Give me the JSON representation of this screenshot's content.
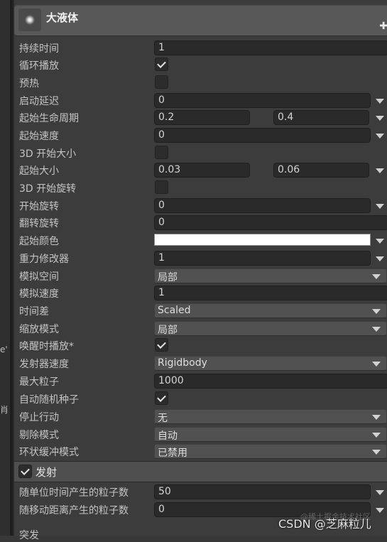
{
  "header": {
    "title": "大液体",
    "icon": "particle-system-icon",
    "add_icon": "plus-icon"
  },
  "rows": {
    "duration": {
      "label": "持续时间",
      "value": "1"
    },
    "looping": {
      "label": "循环播放",
      "checked": true
    },
    "prewarm": {
      "label": "预热",
      "checked": false
    },
    "start_delay": {
      "label": "启动延迟",
      "value": "0"
    },
    "start_lifetime": {
      "label": "起始生命周期",
      "min": "0.2",
      "max": "0.4"
    },
    "start_speed": {
      "label": "起始速度",
      "value": "0"
    },
    "start_size_3d": {
      "label": "3D 开始大小",
      "checked": false
    },
    "start_size": {
      "label": "起始大小",
      "min": "0.03",
      "max": "0.06"
    },
    "start_rotation_3d": {
      "label": "3D 开始旋转",
      "checked": false
    },
    "start_rotation": {
      "label": "开始旋转",
      "value": "0"
    },
    "flip_rotation": {
      "label": "翻转旋转",
      "value": "0"
    },
    "start_color": {
      "label": "起始颜色",
      "color": "#ffffff"
    },
    "gravity_modifier": {
      "label": "重力修改器",
      "value": "1"
    },
    "simulation_space": {
      "label": "模拟空间",
      "selected": "局部"
    },
    "simulation_speed": {
      "label": "模拟速度",
      "value": "1"
    },
    "delta_time": {
      "label": "时间差",
      "selected": "Scaled"
    },
    "scaling_mode": {
      "label": "缩放模式",
      "selected": "局部"
    },
    "play_on_awake": {
      "label": "唤醒时播放*",
      "checked": true
    },
    "emitter_velocity": {
      "label": "发射器速度",
      "selected": "Rigidbody"
    },
    "max_particles": {
      "label": "最大粒子",
      "value": "1000"
    },
    "auto_random_seed": {
      "label": "自动随机种子",
      "checked": true
    },
    "stop_action": {
      "label": "停止行动",
      "selected": "无"
    },
    "culling_mode": {
      "label": "剔除模式",
      "selected": "自动"
    },
    "ring_buffer_mode": {
      "label": "环状缓冲模式",
      "selected": "已禁用"
    }
  },
  "emission": {
    "title": "发射",
    "enabled": true,
    "rate_over_time": {
      "label": "随单位时间产生的粒子数",
      "value": "50"
    },
    "rate_over_distance": {
      "label": "随移动距离产生的粒子数",
      "value": "0"
    },
    "next_label": "突发"
  },
  "left_glyphs": [
    "e'",
    "肖"
  ],
  "watermark": {
    "main": "CSDN @芝麻粒儿",
    "sub": "@稀土掘金技术社区"
  }
}
